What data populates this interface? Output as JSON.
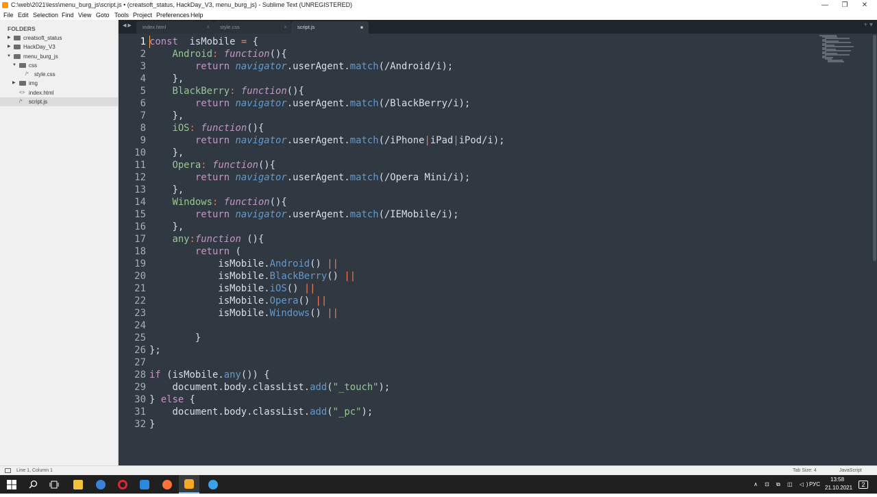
{
  "window": {
    "title": "C:\\web\\2021\\less\\menu_burg_js\\script.js • (creatsoft_status, HackDay_V3, menu_burg_js) - Sublime Text (UNREGISTERED)",
    "controls": {
      "minimize": "—",
      "maximize": "❐",
      "close": "✕"
    }
  },
  "menubar": [
    "File",
    "Edit",
    "Selection",
    "Find",
    "View",
    "Goto",
    "Tools",
    "Project",
    "Preferences",
    "Help"
  ],
  "sidebar": {
    "header": "FOLDERS",
    "items": [
      {
        "label": "creatsoft_status",
        "type": "folder",
        "state": "collapsed"
      },
      {
        "label": "HackDay_V3",
        "type": "folder",
        "state": "collapsed"
      },
      {
        "label": "menu_burg_js",
        "type": "folder",
        "state": "expanded"
      },
      {
        "label": "css",
        "type": "folder",
        "state": "expanded"
      },
      {
        "label": "style.css",
        "type": "file",
        "glyph": "/*"
      },
      {
        "label": "img",
        "type": "folder",
        "state": "collapsed"
      },
      {
        "label": "index.html",
        "type": "file",
        "glyph": "<>"
      },
      {
        "label": "script.js",
        "type": "file",
        "glyph": "/*",
        "selected": true
      }
    ]
  },
  "tabs": [
    {
      "label": "index.html",
      "close": "×"
    },
    {
      "label": "style.css",
      "close": "×"
    },
    {
      "label": "script.js",
      "active": true,
      "modified": true
    }
  ],
  "tab_nav": "◀ ▶",
  "tab_actions": "+ ▾",
  "editor": {
    "current_line": 1,
    "lines": [
      [
        [
          "kw",
          "const"
        ],
        [
          "",
          "  isMobile "
        ],
        [
          "op",
          "="
        ],
        [
          "",
          " {"
        ]
      ],
      [
        [
          "",
          "    "
        ],
        [
          "pr",
          "Android"
        ],
        [
          "op",
          ":"
        ],
        [
          "",
          " "
        ],
        [
          "it",
          "function"
        ],
        [
          "",
          "(){"
        ]
      ],
      [
        [
          "",
          "        "
        ],
        [
          "kw",
          "return"
        ],
        [
          "",
          " "
        ],
        [
          "obj",
          "navigator"
        ],
        [
          "",
          ".userAgent."
        ],
        [
          "fn",
          "match"
        ],
        [
          "",
          "(/Android/i);"
        ]
      ],
      [
        [
          "",
          "    },"
        ]
      ],
      [
        [
          "",
          "    "
        ],
        [
          "pr",
          "BlackBerry"
        ],
        [
          "op",
          ":"
        ],
        [
          "",
          " "
        ],
        [
          "it",
          "function"
        ],
        [
          "",
          "(){"
        ]
      ],
      [
        [
          "",
          "        "
        ],
        [
          "kw",
          "return"
        ],
        [
          "",
          " "
        ],
        [
          "obj",
          "navigator"
        ],
        [
          "",
          ".userAgent."
        ],
        [
          "fn",
          "match"
        ],
        [
          "",
          "(/BlackBerry/i);"
        ]
      ],
      [
        [
          "",
          "    },"
        ]
      ],
      [
        [
          "",
          "    "
        ],
        [
          "pr",
          "iOS"
        ],
        [
          "op",
          ":"
        ],
        [
          "",
          " "
        ],
        [
          "it",
          "function"
        ],
        [
          "",
          "(){"
        ]
      ],
      [
        [
          "",
          "        "
        ],
        [
          "kw",
          "return"
        ],
        [
          "",
          " "
        ],
        [
          "obj",
          "navigator"
        ],
        [
          "",
          ".userAgent."
        ],
        [
          "fn",
          "match"
        ],
        [
          "",
          "(/iPhone"
        ],
        [
          "op",
          "|"
        ],
        [
          "",
          "iPad"
        ],
        [
          "op",
          "|"
        ],
        [
          "",
          "iPod/i);"
        ]
      ],
      [
        [
          "",
          "    },"
        ]
      ],
      [
        [
          "",
          "    "
        ],
        [
          "pr",
          "Opera"
        ],
        [
          "op",
          ":"
        ],
        [
          "",
          " "
        ],
        [
          "it",
          "function"
        ],
        [
          "",
          "(){"
        ]
      ],
      [
        [
          "",
          "        "
        ],
        [
          "kw",
          "return"
        ],
        [
          "",
          " "
        ],
        [
          "obj",
          "navigator"
        ],
        [
          "",
          ".userAgent."
        ],
        [
          "fn",
          "match"
        ],
        [
          "",
          "(/Opera Mini/i);"
        ]
      ],
      [
        [
          "",
          "    },"
        ]
      ],
      [
        [
          "",
          "    "
        ],
        [
          "pr",
          "Windows"
        ],
        [
          "op",
          ":"
        ],
        [
          "",
          " "
        ],
        [
          "it",
          "function"
        ],
        [
          "",
          "(){"
        ]
      ],
      [
        [
          "",
          "        "
        ],
        [
          "kw",
          "return"
        ],
        [
          "",
          " "
        ],
        [
          "obj",
          "navigator"
        ],
        [
          "",
          ".userAgent."
        ],
        [
          "fn",
          "match"
        ],
        [
          "",
          "(/IEMobile/i);"
        ]
      ],
      [
        [
          "",
          "    },"
        ]
      ],
      [
        [
          "",
          "    "
        ],
        [
          "pr",
          "any"
        ],
        [
          "op",
          ":"
        ],
        [
          "it",
          "function"
        ],
        [
          "",
          " (){"
        ]
      ],
      [
        [
          "",
          "        "
        ],
        [
          "kw",
          "return"
        ],
        [
          "",
          " ("
        ]
      ],
      [
        [
          "",
          "            isMobile."
        ],
        [
          "fn",
          "Android"
        ],
        [
          "",
          "() "
        ],
        [
          "op",
          "||"
        ]
      ],
      [
        [
          "",
          "            isMobile."
        ],
        [
          "fn",
          "BlackBerry"
        ],
        [
          "",
          "() "
        ],
        [
          "op",
          "||"
        ]
      ],
      [
        [
          "",
          "            isMobile."
        ],
        [
          "fn",
          "iOS"
        ],
        [
          "",
          "() "
        ],
        [
          "op",
          "||"
        ]
      ],
      [
        [
          "",
          "            isMobile."
        ],
        [
          "fn",
          "Opera"
        ],
        [
          "",
          "() "
        ],
        [
          "op",
          "||"
        ]
      ],
      [
        [
          "",
          "            isMobile."
        ],
        [
          "fn",
          "Windows"
        ],
        [
          "",
          "() "
        ],
        [
          "op",
          "||"
        ]
      ],
      [
        [
          "",
          ""
        ]
      ],
      [
        [
          "",
          "        }"
        ]
      ],
      [
        [
          "",
          "};"
        ]
      ],
      [
        [
          "",
          ""
        ]
      ],
      [
        [
          "kw",
          "if"
        ],
        [
          "",
          " (isMobile."
        ],
        [
          "fn",
          "any"
        ],
        [
          "",
          "()) {"
        ]
      ],
      [
        [
          "",
          "    document.body.classList."
        ],
        [
          "fn",
          "add"
        ],
        [
          "",
          "("
        ],
        [
          "str",
          "\"_touch\""
        ],
        [
          "",
          ");"
        ]
      ],
      [
        [
          "",
          "} "
        ],
        [
          "kw",
          "else"
        ],
        [
          "",
          " {"
        ]
      ],
      [
        [
          "",
          "    document.body.classList."
        ],
        [
          "fn",
          "add"
        ],
        [
          "",
          "("
        ],
        [
          "str",
          "\"_pc\""
        ],
        [
          "",
          ");"
        ]
      ],
      [
        [
          "",
          "}"
        ]
      ]
    ]
  },
  "statusbar": {
    "position": "Line 1, Column 1",
    "tab_size": "Tab Size: 4",
    "syntax": "JavaScript"
  },
  "taskbar": {
    "apps": [
      {
        "name": "windows-start",
        "color": "#ffffff"
      },
      {
        "name": "search",
        "color": "#ffffff"
      },
      {
        "name": "task-view",
        "color": "#ffffff"
      },
      {
        "name": "file-explorer",
        "color": "#f3c13a"
      },
      {
        "name": "browser",
        "color": "#3b82d6"
      },
      {
        "name": "opera",
        "color": "#e0262f"
      },
      {
        "name": "vscode",
        "color": "#2a8ae0"
      },
      {
        "name": "firefox",
        "color": "#ff7139"
      },
      {
        "name": "sublime-text",
        "color": "#f9a825",
        "active": true
      },
      {
        "name": "chrome",
        "color": "#3aa1e8"
      }
    ],
    "tray": {
      "icons": "∧ ⊡ ⧉ ◫ ◁)",
      "language": "РУС",
      "time": "13:58",
      "date": "21.10.2021",
      "notifications": "2"
    }
  }
}
